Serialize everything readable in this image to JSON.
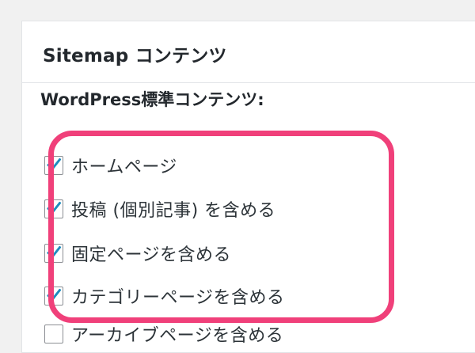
{
  "panel": {
    "title": "Sitemap コンテンツ"
  },
  "section": {
    "heading": "WordPress標準コンテンツ:"
  },
  "options": [
    {
      "label": "ホームページ",
      "checked": true
    },
    {
      "label": "投稿 (個別記事) を含める",
      "checked": true
    },
    {
      "label": "固定ページを含める",
      "checked": true
    },
    {
      "label": "カテゴリーページを含める",
      "checked": true
    },
    {
      "label": "アーカイブページを含める",
      "checked": false
    }
  ],
  "colors": {
    "highlight": "#f0407a",
    "checkmark": "#1e8cbe"
  }
}
